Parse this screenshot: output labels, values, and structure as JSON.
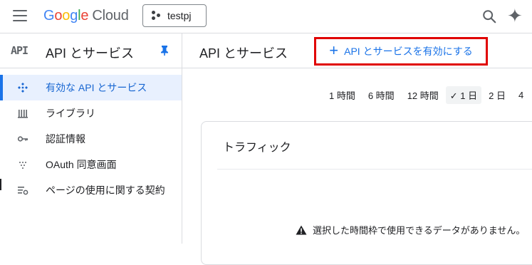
{
  "header": {
    "logo_letters": [
      "G",
      "o",
      "o",
      "g",
      "l",
      "e"
    ],
    "logo_suffix": "Cloud",
    "project_name": "testpj"
  },
  "sidebar": {
    "api_logo": "API",
    "title": "API とサービス",
    "items": [
      {
        "label": "有効な API とサービス",
        "icon": "api-diamond-icon",
        "active": true
      },
      {
        "label": "ライブラリ",
        "icon": "library-icon",
        "active": false
      },
      {
        "label": "認証情報",
        "icon": "key-icon",
        "active": false
      },
      {
        "label": "OAuth 同意画面",
        "icon": "oauth-consent-icon",
        "active": false
      },
      {
        "label": "ページの使用に関する契約",
        "icon": "page-usage-agreement-icon",
        "active": false
      }
    ]
  },
  "main": {
    "title": "API とサービス",
    "enable_button": "API とサービスを有効にする",
    "time_ranges": [
      "1 時間",
      "6 時間",
      "12 時間",
      "1 日",
      "2 日",
      "4"
    ],
    "selected_range": "1 日",
    "card_title": "トラフィック",
    "no_data_message": "選択した時間枠で使用できるデータがありません。"
  },
  "colors": {
    "accent": "#1a73e8",
    "highlight_box": "#e00000",
    "active_bg": "#e8f0fe"
  }
}
